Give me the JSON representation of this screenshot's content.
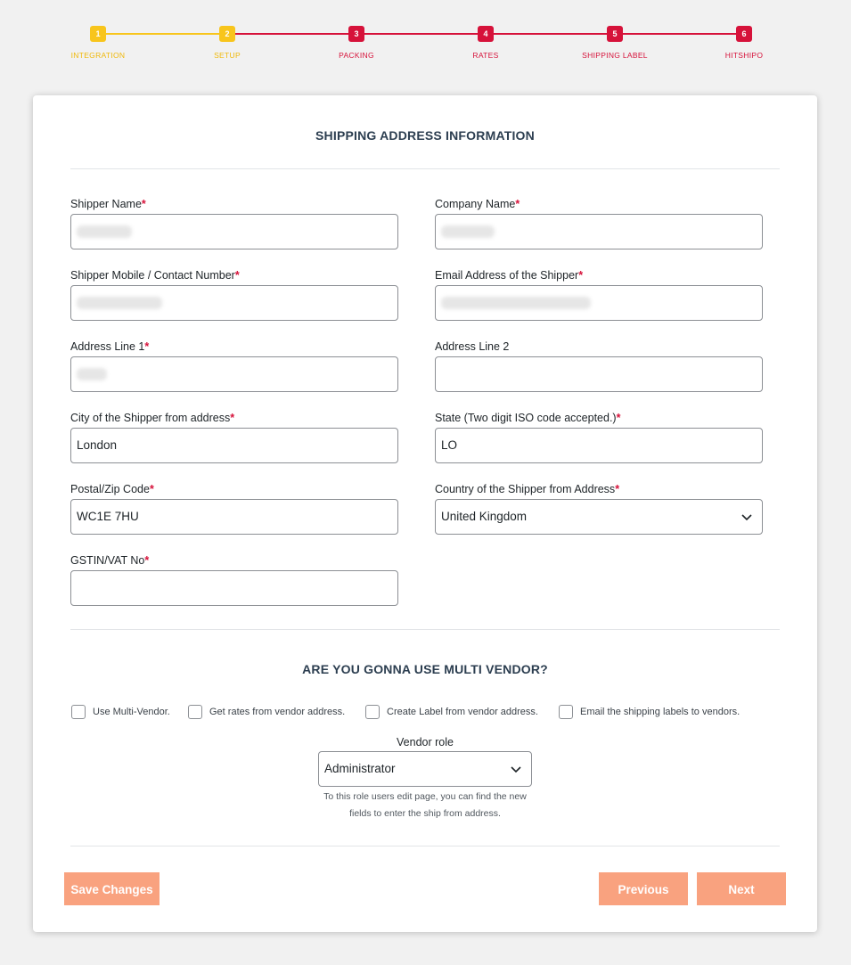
{
  "stepper": {
    "steps": [
      {
        "number": "1",
        "label": "INTEGRATION"
      },
      {
        "number": "2",
        "label": "SETUP"
      },
      {
        "number": "3",
        "label": "PACKING"
      },
      {
        "number": "4",
        "label": "RATES"
      },
      {
        "number": "5",
        "label": "SHIPPING LABEL"
      },
      {
        "number": "6",
        "label": "HITSHIPO"
      }
    ],
    "colors": {
      "completed": "#f8c51c",
      "pending": "#d6123a"
    }
  },
  "address_section": {
    "title": "SHIPPING ADDRESS INFORMATION",
    "fields": {
      "shipper_name": {
        "label": "Shipper Name",
        "required": "*",
        "value": ""
      },
      "company_name": {
        "label": "Company Name",
        "required": "*",
        "value": ""
      },
      "shipper_mobile": {
        "label": "Shipper Mobile / Contact Number",
        "required": "*",
        "value": ""
      },
      "shipper_email": {
        "label": "Email Address of the Shipper",
        "required": "*",
        "value": ""
      },
      "address_line_1": {
        "label": "Address Line 1",
        "required": "*",
        "value": ""
      },
      "address_line_2": {
        "label": "Address Line 2",
        "value": ""
      },
      "city": {
        "label": "City of the Shipper from address",
        "required": "*",
        "value": "London"
      },
      "state": {
        "label": "State (Two digit ISO code accepted.)",
        "required": "*",
        "value": "LO"
      },
      "postal_code": {
        "label": "Postal/Zip Code",
        "required": "*",
        "value": "WC1E 7HU"
      },
      "country": {
        "label": "Country of the Shipper from Address",
        "required": "*",
        "value": "United Kingdom"
      },
      "gstin_vat": {
        "label": "GSTIN/VAT No",
        "required": "*",
        "value": ""
      }
    }
  },
  "vendor_section": {
    "title": "ARE YOU GONNA USE MULTI VENDOR?",
    "checkboxes": [
      {
        "label": "Use Multi-Vendor.",
        "checked": false
      },
      {
        "label": "Get rates from vendor address.",
        "checked": false
      },
      {
        "label": "Create Label from vendor address.",
        "checked": false
      },
      {
        "label": "Email the shipping labels to vendors.",
        "checked": false
      }
    ],
    "vendor_role": {
      "label": "Vendor role",
      "value": "Administrator",
      "help_line_1": "To this role users edit page, you can find the new",
      "help_line_2": "fields to enter the ship from address."
    }
  },
  "actions": {
    "save_label": "Save Changes",
    "previous_label": "Previous",
    "next_label": "Next",
    "button_color": "#f9a27f"
  }
}
